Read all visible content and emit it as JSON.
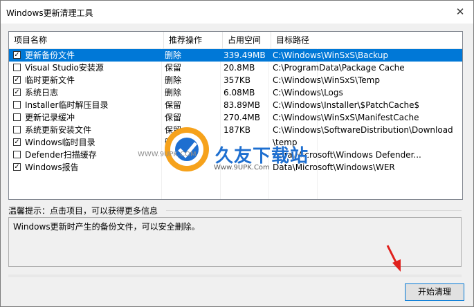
{
  "window": {
    "title": "Windows更新清理工具",
    "close_glyph": "✕"
  },
  "table": {
    "columns": [
      "项目名称",
      "推荐操作",
      "占用空间",
      "目标路径"
    ],
    "rows": [
      {
        "checked": true,
        "name": "更新备份文件",
        "action": "删除",
        "size": "339.49MB",
        "path": "C:\\Windows\\WinSxS\\Backup",
        "selected": true
      },
      {
        "checked": false,
        "name": "Visual Studio安装源",
        "action": "保留",
        "size": "20.8MB",
        "path": "C:\\ProgramData\\Package Cache"
      },
      {
        "checked": true,
        "name": "临时更新文件",
        "action": "删除",
        "size": "357KB",
        "path": "C:\\Windows\\WinSxS\\Temp"
      },
      {
        "checked": true,
        "name": "系统日志",
        "action": "删除",
        "size": "6.08MB",
        "path": "C:\\Windows\\Logs"
      },
      {
        "checked": false,
        "name": "Installer临时解压目录",
        "action": "保留",
        "size": "83.89MB",
        "path": "C:\\Windows\\Installer\\$PatchCache$"
      },
      {
        "checked": false,
        "name": "更新记录缓冲",
        "action": "保留",
        "size": "270.4MB",
        "path": "C:\\Windows\\WinSxS\\ManifestCache"
      },
      {
        "checked": false,
        "name": "系统更新安装文件",
        "action": "保留",
        "size": "187KB",
        "path": "C:\\Windows\\SoftwareDistribution\\Download"
      },
      {
        "checked": true,
        "name": "Windows临时目录",
        "action": "删除",
        "size": "",
        "path": "\\temp"
      },
      {
        "checked": false,
        "name": "Defender扫描缓存",
        "action": "",
        "size": "",
        "path": "Data\\Microsoft\\Windows Defender..."
      },
      {
        "checked": true,
        "name": "Windows报告",
        "action": "",
        "size": "",
        "path": "Data\\Microsoft\\Windows\\WER"
      }
    ]
  },
  "watermark": {
    "brand": "久友下载站",
    "url": "Www.9UPK.Com",
    "left_text": "WWW.9UPK.COM"
  },
  "tips": {
    "label": "温馨提示：点击项目，可以获得更多信息",
    "text": "Windows更新时产生的备份文件，可以安全删除。"
  },
  "start_button": {
    "label": "开始清理"
  },
  "colors": {
    "selection": "#0078d7",
    "arrow": "#e0201c",
    "brand": "#1e6fd0"
  }
}
